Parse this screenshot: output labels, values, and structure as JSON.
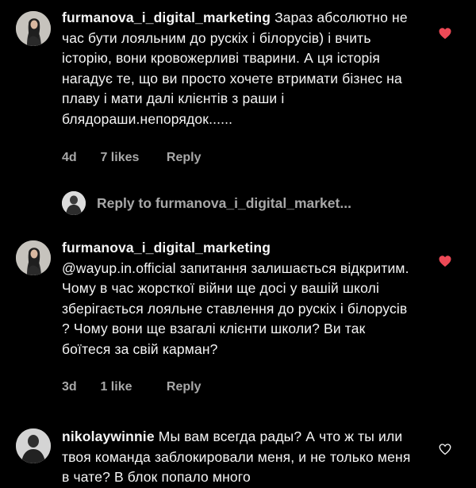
{
  "comments": [
    {
      "username": "furmanova_i_digital_marketing",
      "text": "Зараз абсолютно не час бути лояльним до рускіх і білорусів) і вчить історію, вони кровожерливі тварини. А ця історія нагадує те, що ви просто хочете втримати бізнес на плаву і мати далі клієнтів з раши і блядораши.непорядок......",
      "time": "4d",
      "likes": "7 likes",
      "reply_label": "Reply",
      "liked": true
    },
    {
      "username": "furmanova_i_digital_marketing",
      "text": "@wayup.in.official запитання залишається відкритим. Чому в час жорсткої війни ще досі у вашій школі зберігається лояльне ставлення до рускіх і білорусів ? Чому вони ще взагалі клієнти школи? Ви так боїтеся за свій карман?",
      "time": "3d",
      "likes": "1 like",
      "reply_label": "Reply",
      "liked": true
    },
    {
      "username": "nikolaywinnie",
      "text": "Мы вам всегда рады? А что ж ты или твоя команда заблокировали меня, и не только меня в чате? В блок попало много",
      "liked": false
    }
  ],
  "reply_thread": {
    "label": "Reply to furmanova_i_digital_market..."
  },
  "colors": {
    "background": "#000000",
    "text": "#f5f5f5",
    "secondary_text": "#a8a8a8",
    "like_active": "#ed4956"
  },
  "icons": {
    "liked": "heart-filled-icon",
    "unliked": "heart-outline-icon"
  }
}
